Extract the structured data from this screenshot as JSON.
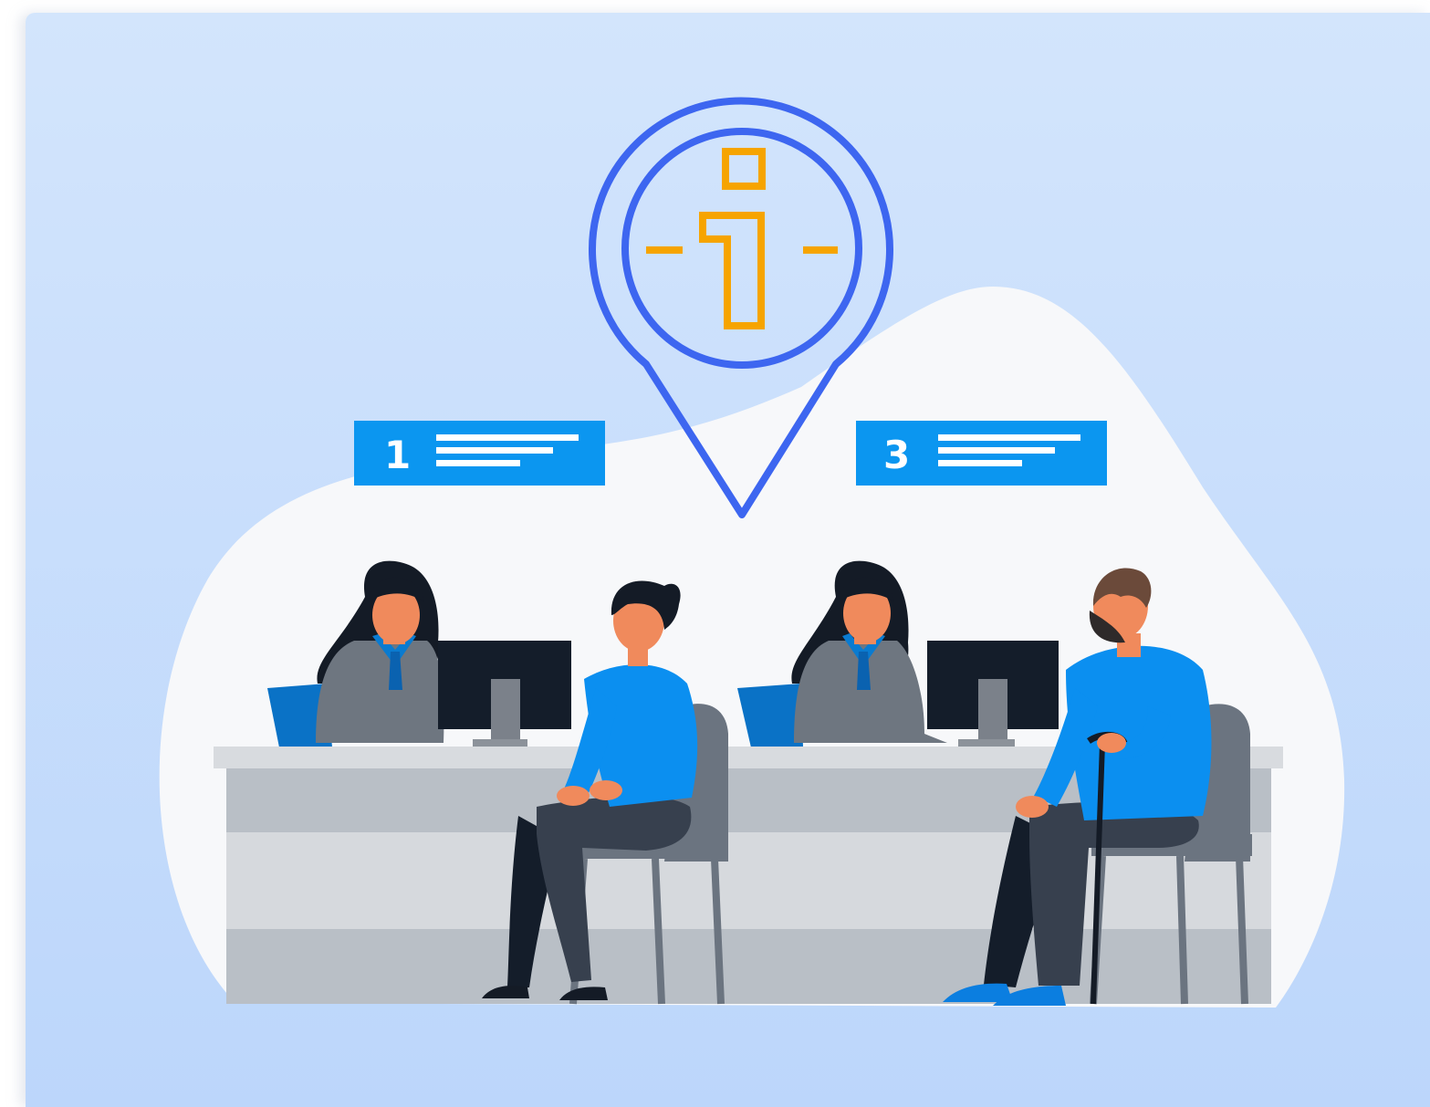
{
  "scene": {
    "sign_left": {
      "number": "1"
    },
    "sign_right": {
      "number": "3"
    },
    "info_pin": {
      "icon": "info-icon"
    },
    "colors": {
      "background_top": "#d2e4fb",
      "background_bottom": "#bcd7fb",
      "blob": "#f7f8fa",
      "pin_stroke": "#3d66f0",
      "info_glyph": "#f6a400",
      "sign_fill": "#0b96f0",
      "counter_light": "#dcdfe3",
      "counter_dark": "#b9bfc6",
      "customer_shirt": "#0b8ff0",
      "clerk_jacket": "#6e7680",
      "monitor": "#141d2a",
      "skin": "#f08a5c"
    }
  }
}
